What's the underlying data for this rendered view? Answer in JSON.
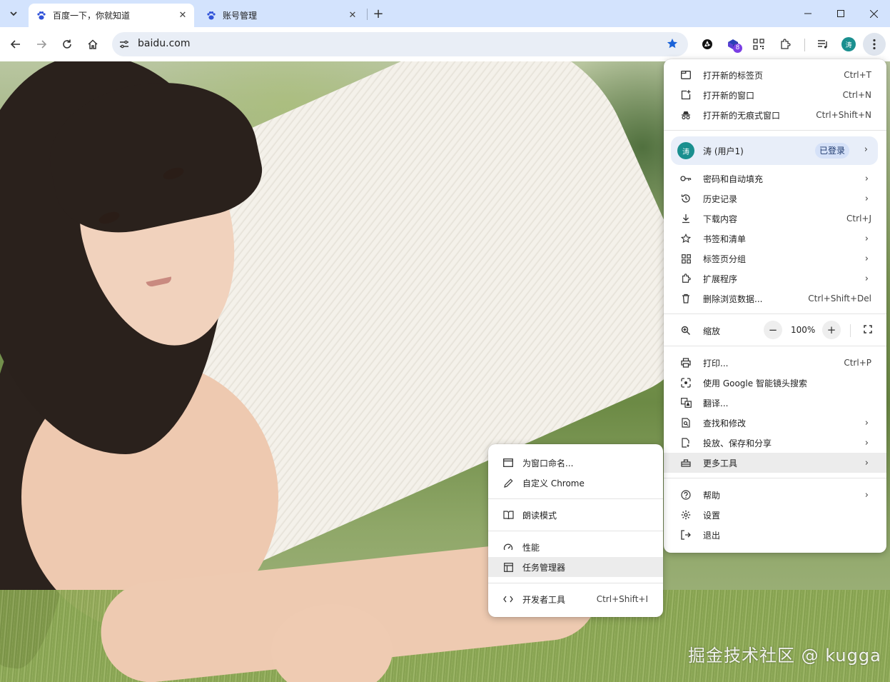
{
  "tabs": [
    {
      "title": "百度一下，你就知道",
      "active": true,
      "favicon": "baidu-paw-icon"
    },
    {
      "title": "账号管理",
      "active": false,
      "favicon": "baidu-paw-icon"
    }
  ],
  "address_bar": {
    "url": "baidu.com"
  },
  "toolbar": {
    "extension_badge": "8",
    "profile_initial": "涛"
  },
  "menu": {
    "new_tab": {
      "label": "打开新的标签页",
      "shortcut": "Ctrl+T"
    },
    "new_window": {
      "label": "打开新的窗口",
      "shortcut": "Ctrl+N"
    },
    "incognito": {
      "label": "打开新的无痕式窗口",
      "shortcut": "Ctrl+Shift+N"
    },
    "profile": {
      "initial": "涛",
      "name": "涛 (用户1)",
      "status": "已登录"
    },
    "passwords": {
      "label": "密码和自动填充"
    },
    "history": {
      "label": "历史记录"
    },
    "downloads": {
      "label": "下载内容",
      "shortcut": "Ctrl+J"
    },
    "bookmarks": {
      "label": "书签和清单"
    },
    "tab_groups": {
      "label": "标签页分组"
    },
    "extensions": {
      "label": "扩展程序"
    },
    "clear_data": {
      "label": "删除浏览数据...",
      "shortcut": "Ctrl+Shift+Del"
    },
    "zoom": {
      "label": "缩放",
      "value": "100%",
      "minus": "−",
      "plus": "+"
    },
    "print": {
      "label": "打印...",
      "shortcut": "Ctrl+P"
    },
    "google_lens": {
      "label": "使用 Google 智能镜头搜索"
    },
    "translate": {
      "label": "翻译..."
    },
    "find_edit": {
      "label": "查找和修改"
    },
    "cast_save_share": {
      "label": "投放、保存和分享"
    },
    "more_tools": {
      "label": "更多工具"
    },
    "help": {
      "label": "帮助"
    },
    "settings": {
      "label": "设置"
    },
    "exit": {
      "label": "退出"
    }
  },
  "submenu": {
    "name_window": {
      "label": "为窗口命名..."
    },
    "customize_chrome": {
      "label": "自定义 Chrome"
    },
    "reading_mode": {
      "label": "朗读模式"
    },
    "performance": {
      "label": "性能"
    },
    "task_manager": {
      "label": "任务管理器"
    },
    "dev_tools": {
      "label": "开发者工具",
      "shortcut": "Ctrl+Shift+I"
    }
  },
  "watermark": "掘金技术社区 @ kugga",
  "colors": {
    "tabstrip": "#d3e3fd",
    "accent": "#1a73e8",
    "avatar": "#1a8f8f"
  }
}
